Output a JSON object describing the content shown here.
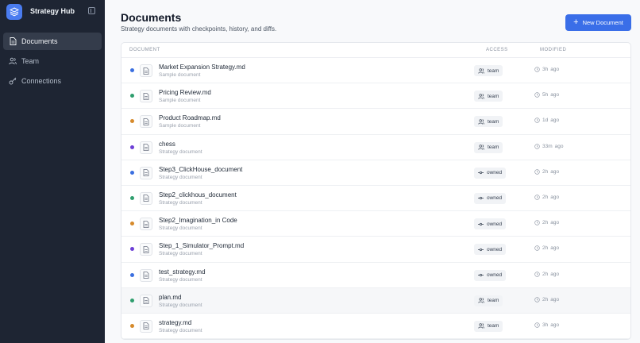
{
  "app": {
    "name": "Strategy Hub"
  },
  "sidebar": {
    "items": [
      {
        "label": "Documents",
        "icon": "file-icon",
        "active": true
      },
      {
        "label": "Team",
        "icon": "users-icon",
        "active": false
      },
      {
        "label": "Connections",
        "icon": "key-icon",
        "active": false
      }
    ]
  },
  "header": {
    "title": "Documents",
    "subtitle": "Strategy documents with checkpoints, history, and diffs.",
    "new_button": "New Document"
  },
  "table": {
    "columns": {
      "document": "DOCUMENT",
      "access": "ACCESS",
      "modified": "MODIFIED"
    },
    "rows": [
      {
        "name": "Market Expansion Strategy.md",
        "sub": "Sample document",
        "access": "team",
        "time": "3h",
        "ago": "ago",
        "dot": "#3b6fe0"
      },
      {
        "name": "Pricing Review.md",
        "sub": "Sample document",
        "access": "team",
        "time": "5h",
        "ago": "ago",
        "dot": "#2f9e6e"
      },
      {
        "name": "Product Roadmap.md",
        "sub": "Sample document",
        "access": "team",
        "time": "1d",
        "ago": "ago",
        "dot": "#d68a2b"
      },
      {
        "name": "chess",
        "sub": "Strategy document",
        "access": "team",
        "time": "33m",
        "ago": "ago",
        "dot": "#6d3fd6"
      },
      {
        "name": "Step3_ClickHouse_document",
        "sub": "Strategy document",
        "access": "owned",
        "time": "2h",
        "ago": "ago",
        "dot": "#3b6fe0"
      },
      {
        "name": "Step2_clickhous_document",
        "sub": "Strategy document",
        "access": "owned",
        "time": "2h",
        "ago": "ago",
        "dot": "#2f9e6e"
      },
      {
        "name": "Step2_Imagination_in Code",
        "sub": "Strategy document",
        "access": "owned",
        "time": "2h",
        "ago": "ago",
        "dot": "#d68a2b"
      },
      {
        "name": "Step_1_Simulator_Prompt.md",
        "sub": "Strategy document",
        "access": "owned",
        "time": "2h",
        "ago": "ago",
        "dot": "#6d3fd6"
      },
      {
        "name": "test_strategy.md",
        "sub": "Strategy document",
        "access": "owned",
        "time": "2h",
        "ago": "ago",
        "dot": "#3b6fe0"
      },
      {
        "name": "plan.md",
        "sub": "Strategy document",
        "access": "team",
        "time": "2h",
        "ago": "ago",
        "dot": "#2f9e6e",
        "highlight": true
      },
      {
        "name": "strategy.md",
        "sub": "Strategy document",
        "access": "team",
        "time": "3h",
        "ago": "ago",
        "dot": "#d68a2b"
      }
    ]
  }
}
